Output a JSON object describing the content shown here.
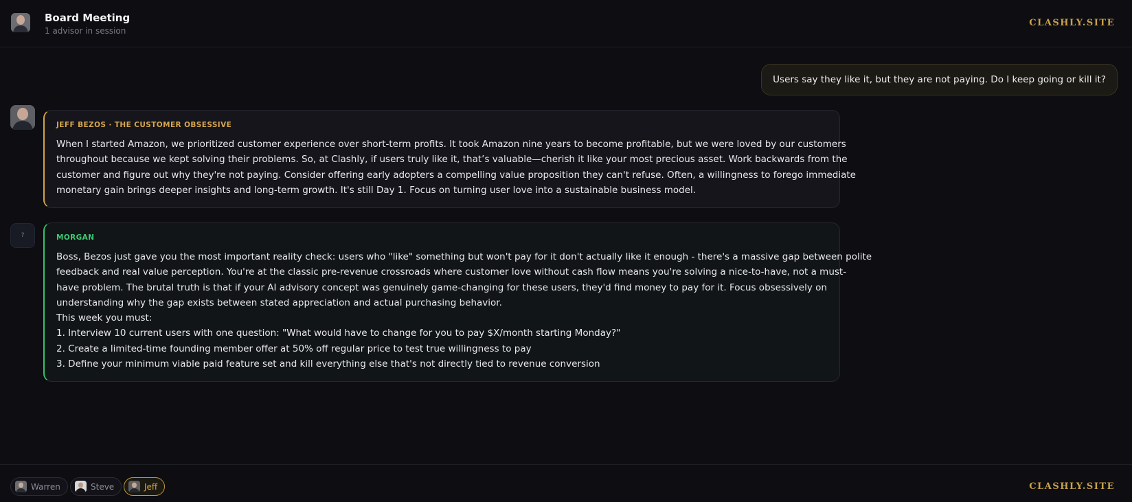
{
  "header": {
    "title": "Board Meeting",
    "subtitle": "1 advisor in session",
    "brand": "CLASHLY.SITE"
  },
  "conversation": {
    "user_message": "Users say they like it, but they are not paying. Do I keep going or kill it?",
    "messages": [
      {
        "speaker": "JEFF BEZOS · THE CUSTOMER OBSESSIVE",
        "avatar": "jeff-avatar",
        "lines": [
          "When I started Amazon, we prioritized customer experience over short-term profits. It took Amazon nine years to become profitable, but we were loved by our customers",
          "throughout because we kept solving their problems. So, at Clashly, if users truly like it, that’s valuable—cherish it like your most precious asset. Work backwards from the",
          "customer and figure out why they're not paying. Consider offering early adopters a compelling value proposition they can't refuse. Often, a willingness to forego immediate",
          "monetary gain brings deeper insights and long-term growth. It's still Day 1. Focus on turning user love into a sustainable business model."
        ]
      },
      {
        "speaker": "MORGAN",
        "avatar_glyph": "?",
        "lines": [
          "Boss, Bezos just gave you the most important reality check: users who \"like\" something but won't pay for it don't actually like it enough - there's a massive gap between polite",
          "feedback and real value perception. You're at the classic pre-revenue crossroads where customer love without cash flow means you're solving a nice-to-have, not a must-",
          "have problem. The brutal truth is that if your AI advisory concept was genuinely game-changing for these users, they'd find money to pay for it. Focus obsessively on",
          "understanding why the gap exists between stated appreciation and actual purchasing behavior.",
          "This week you must:",
          "1. Interview 10 current users with one question: \"What would have to change for you to pay $X/month starting Monday?\"",
          "2. Create a limited-time founding member offer at 50% off regular price to test true willingness to pay",
          "3. Define your minimum viable paid feature set and kill everything else that's not directly tied to revenue conversion"
        ]
      }
    ]
  },
  "footer": {
    "advisors": [
      {
        "label": "Warren",
        "active": false
      },
      {
        "label": "Steve",
        "active": false
      },
      {
        "label": "Jeff",
        "active": true
      }
    ],
    "brand": "CLASHLY.SITE"
  },
  "colors": {
    "accent_gold": "#d7a64c",
    "accent_green": "#3ccb72",
    "background": "#0d0d12"
  }
}
